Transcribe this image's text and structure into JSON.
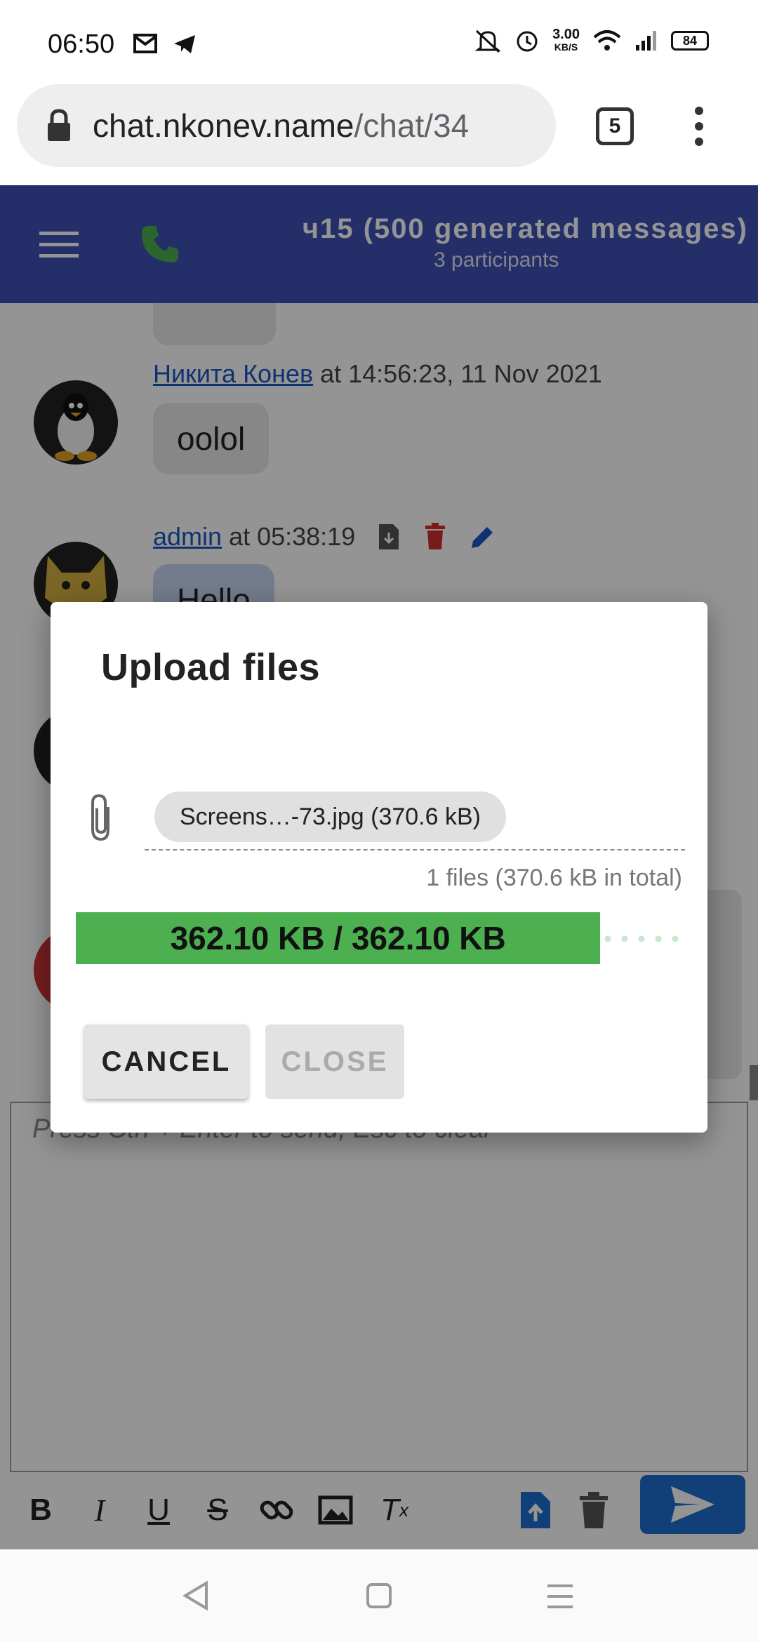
{
  "status_bar": {
    "time": "06:50",
    "net_speed_value": "3.00",
    "net_speed_unit": "KB/S",
    "battery": "84"
  },
  "browser": {
    "url_domain": "chat.nkonev.name",
    "url_path": "/chat/34",
    "tab_count": "5"
  },
  "header": {
    "title": "ч15 (500 generated messages)",
    "subtitle": "3 participants",
    "color": "#3f51b5"
  },
  "messages": [
    {
      "author": "Никита Конев",
      "meta": "at 14:56:23, 11 Nov 2021",
      "text": "oolol"
    },
    {
      "author": "admin",
      "meta": "at 05:38:19",
      "text": "Hello"
    }
  ],
  "editor": {
    "placeholder": "Press Ctrl + Enter to send, Esc to clear"
  },
  "dialog": {
    "title": "Upload files",
    "file_chip": "Screens…-73.jpg (370.6 kB)",
    "files_total": "1 files (370.6 kB in total)",
    "progress_text": "362.10 KB / 362.10 KB",
    "progress_fraction": 0.863,
    "progress_color": "#4caf50",
    "cancel_label": "CANCEL",
    "close_label": "CLOSE"
  },
  "icons": {
    "toolbar": [
      "bold-icon",
      "italic-icon",
      "underline-icon",
      "strikethrough-icon",
      "link-icon",
      "image-icon",
      "clear-format-icon",
      "file-upload-icon",
      "delete-icon",
      "send-icon"
    ],
    "message_actions": [
      "download-file-icon",
      "delete-icon",
      "edit-icon"
    ]
  }
}
